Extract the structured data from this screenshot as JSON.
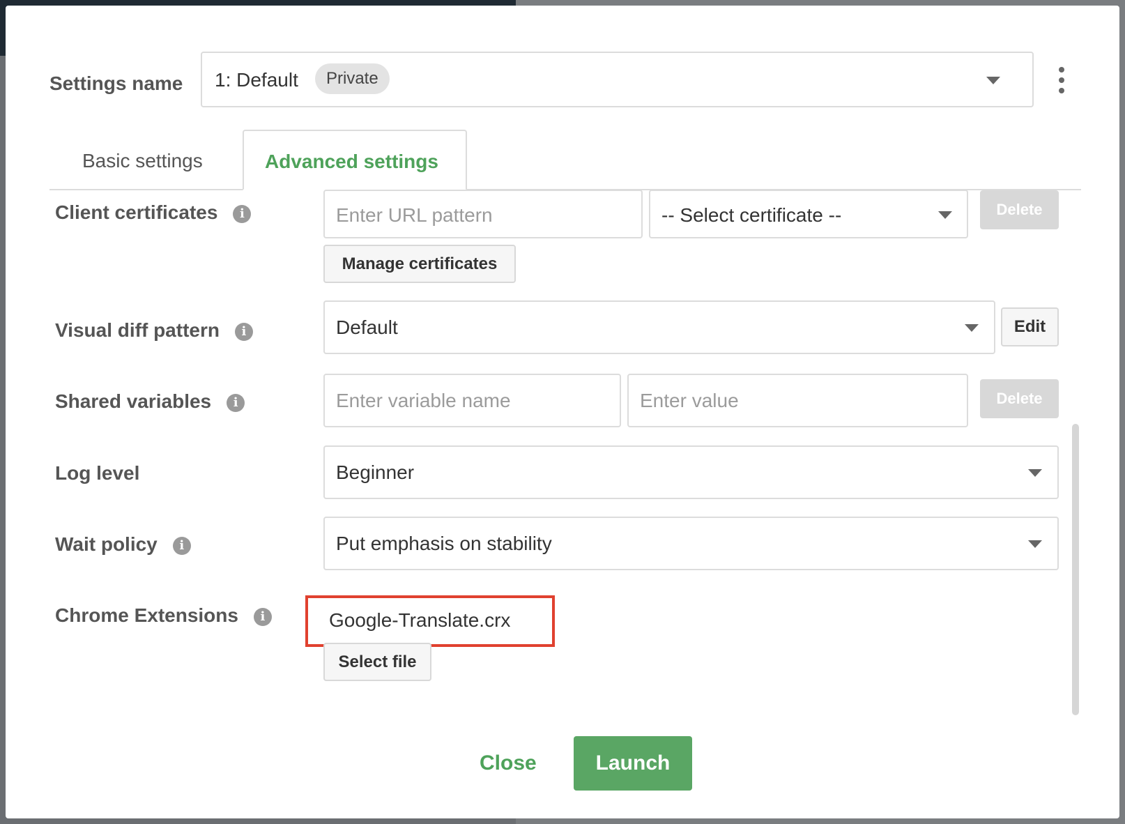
{
  "settings": {
    "label": "Settings name",
    "value": "1: Default",
    "badge": "Private"
  },
  "tabs": [
    {
      "label": "Basic settings",
      "active": false
    },
    {
      "label": "Advanced settings",
      "active": true
    }
  ],
  "client_certificates": {
    "label": "Client certificates",
    "url_placeholder": "Enter URL pattern",
    "certificate_select": "-- Select certificate --",
    "delete_label": "Delete",
    "manage_label": "Manage certificates"
  },
  "visual_diff": {
    "label": "Visual diff pattern",
    "value": "Default",
    "edit_label": "Edit"
  },
  "shared_variables": {
    "label": "Shared variables",
    "name_placeholder": "Enter variable name",
    "value_placeholder": "Enter value",
    "delete_label": "Delete"
  },
  "log_level": {
    "label": "Log level",
    "value": "Beginner"
  },
  "wait_policy": {
    "label": "Wait policy",
    "value": "Put emphasis on stability"
  },
  "chrome_extensions": {
    "label": "Chrome Extensions",
    "file_name": "Google-Translate.crx",
    "select_file_label": "Select file"
  },
  "footer": {
    "close_label": "Close",
    "launch_label": "Launch"
  },
  "icons": {
    "info": "info-icon",
    "caret": "chevron-down-icon",
    "more": "kebab-menu-icon"
  },
  "colors": {
    "accent": "#4ea25a",
    "launch_bg": "#5aa664",
    "highlight": "#e0412f"
  }
}
